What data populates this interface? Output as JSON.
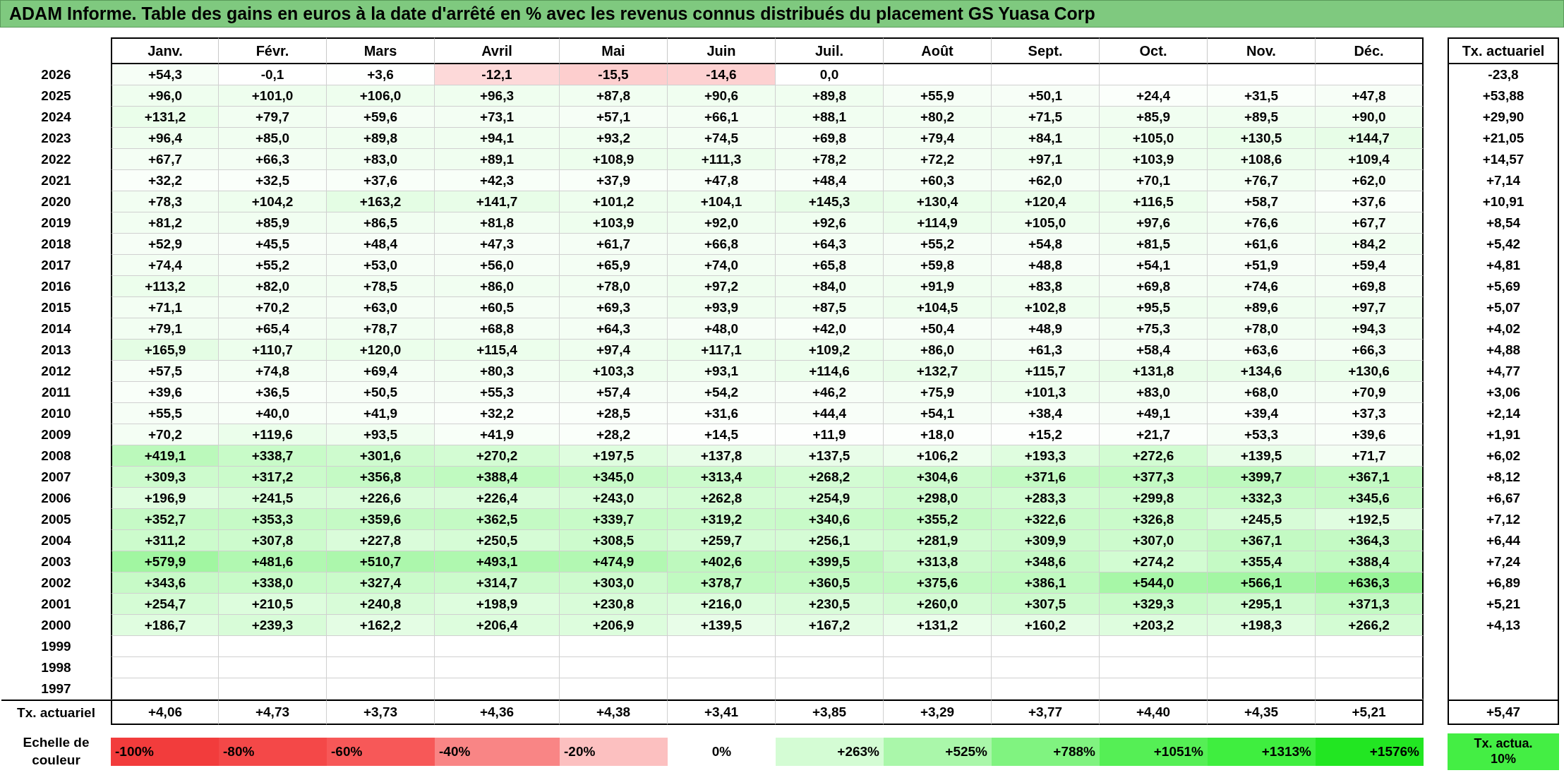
{
  "title": "ADAM Informe. Table des gains en euros à la date d'arrêté en % avec les revenus connus distribués du placement GS Yuasa Corp",
  "months": [
    "Janv.",
    "Févr.",
    "Mars",
    "Avril",
    "Mai",
    "Juin",
    "Juil.",
    "Août",
    "Sept.",
    "Oct.",
    "Nov.",
    "Déc."
  ],
  "rate_header": "Tx. actuariel",
  "rows": [
    {
      "year": "2026",
      "cells": [
        "+54,3",
        "-0,1",
        "+3,6",
        "-12,1",
        "-15,5",
        "-14,6",
        "0,0",
        null,
        null,
        null,
        null,
        null
      ],
      "rate": "-23,8"
    },
    {
      "year": "2025",
      "cells": [
        "+96,0",
        "+101,0",
        "+106,0",
        "+96,3",
        "+87,8",
        "+90,6",
        "+89,8",
        "+55,9",
        "+50,1",
        "+24,4",
        "+31,5",
        "+47,8"
      ],
      "rate": "+53,88"
    },
    {
      "year": "2024",
      "cells": [
        "+131,2",
        "+79,7",
        "+59,6",
        "+73,1",
        "+57,1",
        "+66,1",
        "+88,1",
        "+80,2",
        "+71,5",
        "+85,9",
        "+89,5",
        "+90,0"
      ],
      "rate": "+29,90"
    },
    {
      "year": "2023",
      "cells": [
        "+96,4",
        "+85,0",
        "+89,8",
        "+94,1",
        "+93,2",
        "+74,5",
        "+69,8",
        "+79,4",
        "+84,1",
        "+105,0",
        "+130,5",
        "+144,7"
      ],
      "rate": "+21,05"
    },
    {
      "year": "2022",
      "cells": [
        "+67,7",
        "+66,3",
        "+83,0",
        "+89,1",
        "+108,9",
        "+111,3",
        "+78,2",
        "+72,2",
        "+97,1",
        "+103,9",
        "+108,6",
        "+109,4"
      ],
      "rate": "+14,57"
    },
    {
      "year": "2021",
      "cells": [
        "+32,2",
        "+32,5",
        "+37,6",
        "+42,3",
        "+37,9",
        "+47,8",
        "+48,4",
        "+60,3",
        "+62,0",
        "+70,1",
        "+76,7",
        "+62,0"
      ],
      "rate": "+7,14"
    },
    {
      "year": "2020",
      "cells": [
        "+78,3",
        "+104,2",
        "+163,2",
        "+141,7",
        "+101,2",
        "+104,1",
        "+145,3",
        "+130,4",
        "+120,4",
        "+116,5",
        "+58,7",
        "+37,6"
      ],
      "rate": "+10,91"
    },
    {
      "year": "2019",
      "cells": [
        "+81,2",
        "+85,9",
        "+86,5",
        "+81,8",
        "+103,9",
        "+92,0",
        "+92,6",
        "+114,9",
        "+105,0",
        "+97,6",
        "+76,6",
        "+67,7"
      ],
      "rate": "+8,54"
    },
    {
      "year": "2018",
      "cells": [
        "+52,9",
        "+45,5",
        "+48,4",
        "+47,3",
        "+61,7",
        "+66,8",
        "+64,3",
        "+55,2",
        "+54,8",
        "+81,5",
        "+61,6",
        "+84,2"
      ],
      "rate": "+5,42"
    },
    {
      "year": "2017",
      "cells": [
        "+74,4",
        "+55,2",
        "+53,0",
        "+56,0",
        "+65,9",
        "+74,0",
        "+65,8",
        "+59,8",
        "+48,8",
        "+54,1",
        "+51,9",
        "+59,4"
      ],
      "rate": "+4,81"
    },
    {
      "year": "2016",
      "cells": [
        "+113,2",
        "+82,0",
        "+78,5",
        "+86,0",
        "+78,0",
        "+97,2",
        "+84,0",
        "+91,9",
        "+83,8",
        "+69,8",
        "+74,6",
        "+69,8"
      ],
      "rate": "+5,69"
    },
    {
      "year": "2015",
      "cells": [
        "+71,1",
        "+70,2",
        "+63,0",
        "+60,5",
        "+69,3",
        "+93,9",
        "+87,5",
        "+104,5",
        "+102,8",
        "+95,5",
        "+89,6",
        "+97,7"
      ],
      "rate": "+5,07"
    },
    {
      "year": "2014",
      "cells": [
        "+79,1",
        "+65,4",
        "+78,7",
        "+68,8",
        "+64,3",
        "+48,0",
        "+42,0",
        "+50,4",
        "+48,9",
        "+75,3",
        "+78,0",
        "+94,3"
      ],
      "rate": "+4,02"
    },
    {
      "year": "2013",
      "cells": [
        "+165,9",
        "+110,7",
        "+120,0",
        "+115,4",
        "+97,4",
        "+117,1",
        "+109,2",
        "+86,0",
        "+61,3",
        "+58,4",
        "+63,6",
        "+66,3"
      ],
      "rate": "+4,88"
    },
    {
      "year": "2012",
      "cells": [
        "+57,5",
        "+74,8",
        "+69,4",
        "+80,3",
        "+103,3",
        "+93,1",
        "+114,6",
        "+132,7",
        "+115,7",
        "+131,8",
        "+134,6",
        "+130,6"
      ],
      "rate": "+4,77"
    },
    {
      "year": "2011",
      "cells": [
        "+39,6",
        "+36,5",
        "+50,5",
        "+55,3",
        "+57,4",
        "+54,2",
        "+46,2",
        "+75,9",
        "+101,3",
        "+83,0",
        "+68,0",
        "+70,9"
      ],
      "rate": "+3,06"
    },
    {
      "year": "2010",
      "cells": [
        "+55,5",
        "+40,0",
        "+41,9",
        "+32,2",
        "+28,5",
        "+31,6",
        "+44,4",
        "+54,1",
        "+38,4",
        "+49,1",
        "+39,4",
        "+37,3"
      ],
      "rate": "+2,14"
    },
    {
      "year": "2009",
      "cells": [
        "+70,2",
        "+119,6",
        "+93,5",
        "+41,9",
        "+28,2",
        "+14,5",
        "+11,9",
        "+18,0",
        "+15,2",
        "+21,7",
        "+53,3",
        "+39,6"
      ],
      "rate": "+1,91"
    },
    {
      "year": "2008",
      "cells": [
        "+419,1",
        "+338,7",
        "+301,6",
        "+270,2",
        "+197,5",
        "+137,8",
        "+137,5",
        "+106,2",
        "+193,3",
        "+272,6",
        "+139,5",
        "+71,7"
      ],
      "rate": "+6,02"
    },
    {
      "year": "2007",
      "cells": [
        "+309,3",
        "+317,2",
        "+356,8",
        "+388,4",
        "+345,0",
        "+313,4",
        "+268,2",
        "+304,6",
        "+371,6",
        "+377,3",
        "+399,7",
        "+367,1"
      ],
      "rate": "+8,12"
    },
    {
      "year": "2006",
      "cells": [
        "+196,9",
        "+241,5",
        "+226,6",
        "+226,4",
        "+243,0",
        "+262,8",
        "+254,9",
        "+298,0",
        "+283,3",
        "+299,8",
        "+332,3",
        "+345,6"
      ],
      "rate": "+6,67"
    },
    {
      "year": "2005",
      "cells": [
        "+352,7",
        "+353,3",
        "+359,6",
        "+362,5",
        "+339,7",
        "+319,2",
        "+340,6",
        "+355,2",
        "+322,6",
        "+326,8",
        "+245,5",
        "+192,5"
      ],
      "rate": "+7,12"
    },
    {
      "year": "2004",
      "cells": [
        "+311,2",
        "+307,8",
        "+227,8",
        "+250,5",
        "+308,5",
        "+259,7",
        "+256,1",
        "+281,9",
        "+309,9",
        "+307,0",
        "+367,1",
        "+364,3"
      ],
      "rate": "+6,44"
    },
    {
      "year": "2003",
      "cells": [
        "+579,9",
        "+481,6",
        "+510,7",
        "+493,1",
        "+474,9",
        "+402,6",
        "+399,5",
        "+313,8",
        "+348,6",
        "+274,2",
        "+355,4",
        "+388,4"
      ],
      "rate": "+7,24"
    },
    {
      "year": "2002",
      "cells": [
        "+343,6",
        "+338,0",
        "+327,4",
        "+314,7",
        "+303,0",
        "+378,7",
        "+360,5",
        "+375,6",
        "+386,1",
        "+544,0",
        "+566,1",
        "+636,3"
      ],
      "rate": "+6,89"
    },
    {
      "year": "2001",
      "cells": [
        "+254,7",
        "+210,5",
        "+240,8",
        "+198,9",
        "+230,8",
        "+216,0",
        "+230,5",
        "+260,0",
        "+307,5",
        "+329,3",
        "+295,1",
        "+371,3"
      ],
      "rate": "+5,21"
    },
    {
      "year": "2000",
      "cells": [
        "+186,7",
        "+239,3",
        "+162,2",
        "+206,4",
        "+206,9",
        "+139,5",
        "+167,2",
        "+131,2",
        "+160,2",
        "+203,2",
        "+198,3",
        "+266,2"
      ],
      "rate": "+4,13"
    },
    {
      "year": "1999",
      "cells": [
        null,
        null,
        null,
        null,
        null,
        null,
        null,
        null,
        null,
        null,
        null,
        null
      ],
      "rate": null
    },
    {
      "year": "1998",
      "cells": [
        null,
        null,
        null,
        null,
        null,
        null,
        null,
        null,
        null,
        null,
        null,
        null
      ],
      "rate": null
    },
    {
      "year": "1997",
      "cells": [
        null,
        null,
        null,
        null,
        null,
        null,
        null,
        null,
        null,
        null,
        null,
        null
      ],
      "rate": null
    }
  ],
  "footer": {
    "label": "Tx. actuariel",
    "cells": [
      "+4,06",
      "+4,73",
      "+3,73",
      "+4,36",
      "+4,38",
      "+3,41",
      "+3,85",
      "+3,29",
      "+3,77",
      "+4,40",
      "+4,35",
      "+5,21"
    ],
    "rate": "+5,47"
  },
  "scale": {
    "label": "Echelle de couleur",
    "items": [
      {
        "label": "-100%",
        "color": "#f23c3c"
      },
      {
        "label": "-80%",
        "color": "#f44848"
      },
      {
        "label": "-60%",
        "color": "#f75858"
      },
      {
        "label": "-40%",
        "color": "#f98585"
      },
      {
        "label": "-20%",
        "color": "#fcc0c0"
      },
      {
        "label": "0%",
        "color": "#ffffff"
      },
      {
        "label": "+263%",
        "color": "#d4fcd4"
      },
      {
        "label": "+525%",
        "color": "#aaf7aa"
      },
      {
        "label": "+788%",
        "color": "#80f380"
      },
      {
        "label": "+1051%",
        "color": "#55ef55"
      },
      {
        "label": "+1313%",
        "color": "#3fee3f"
      },
      {
        "label": "+1576%",
        "color": "#22e622"
      }
    ],
    "rate": {
      "label": "Tx. actua. 10%",
      "color": "#44ee44"
    }
  }
}
